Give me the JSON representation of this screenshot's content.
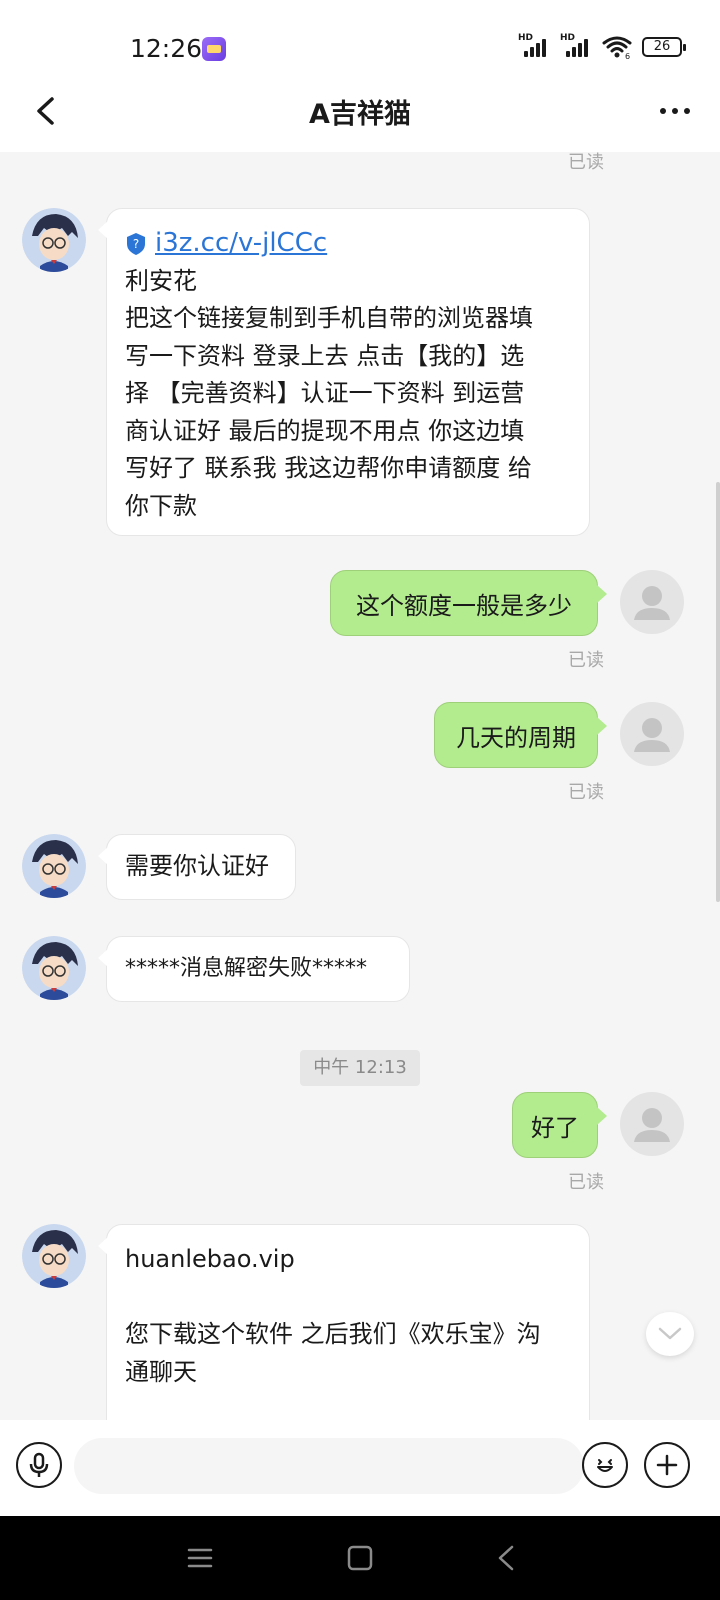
{
  "status_bar": {
    "time": "12:26",
    "signal_label_1": "HD",
    "signal_label_2": "HD",
    "wifi_sub": "6",
    "battery": "26"
  },
  "nav": {
    "title": "A吉祥猫"
  },
  "chat": {
    "read_label": "已读",
    "messages": [
      {
        "link": "i3z.cc/v-jlCCc",
        "lines": [
          "利安花",
          "把这个链接复制到手机自带的浏览器填",
          "写一下资料  登录上去 点击【我的】选",
          "择 【完善资料】认证一下资料 到运营",
          "商认证好 最后的提现不用点   你这边填",
          "写好了 联系我 我这边帮你申请额度 给",
          "你下款"
        ]
      },
      {
        "text": "这个额度一般是多少"
      },
      {
        "text": "几天的周期"
      },
      {
        "text": "需要你认证好"
      },
      {
        "text": "*****消息解密失败*****"
      },
      {
        "time": "中午 12:13"
      },
      {
        "text": "好了"
      },
      {
        "lines": [
          "huanlebao.vip",
          "",
          "您下载这个软件 之后我们《欢乐宝》沟",
          "通聊天"
        ]
      }
    ]
  },
  "input_bar": {
    "placeholder": ""
  },
  "colors": {
    "outgoing_bubble": "#b3eb8f",
    "link": "#2a75d6",
    "background": "#f5f5f5"
  }
}
